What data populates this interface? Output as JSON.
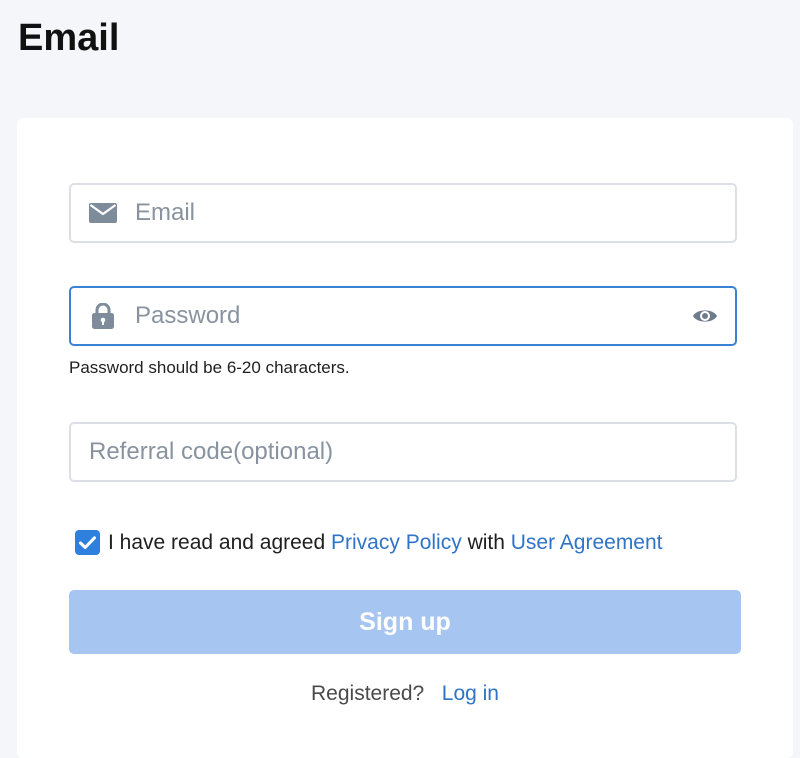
{
  "page": {
    "title": "Email"
  },
  "form": {
    "email": {
      "placeholder": "Email",
      "value": "",
      "icon": "mail-icon"
    },
    "password": {
      "placeholder": "Password",
      "value": "",
      "icon": "lock-icon",
      "toggle_icon": "eye-icon",
      "hint": "Password should be 6-20 characters."
    },
    "referral": {
      "placeholder": "Referral code(optional)",
      "value": ""
    },
    "agreement": {
      "checked": true,
      "prefix": "I have read and agreed",
      "privacy_link": "Privacy Policy",
      "connector": "with",
      "user_agreement_link": "User Agreement"
    },
    "signup_button": "Sign up",
    "login_prompt": "Registered?",
    "login_link": "Log in"
  },
  "colors": {
    "accent": "#2f7fdc",
    "link": "#2f74c8",
    "button_disabled": "#a6c5f0",
    "page_background": "#f4f6fa",
    "focused_border": "#3b82d6"
  }
}
